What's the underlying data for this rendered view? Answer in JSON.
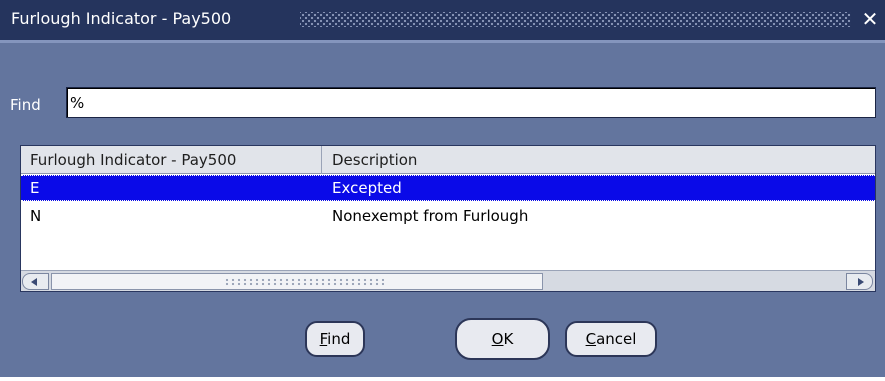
{
  "window": {
    "title": "Furlough Indicator - Pay500",
    "close_label": "✕"
  },
  "find": {
    "label": "Find",
    "value": "%"
  },
  "table": {
    "columns": [
      "Furlough Indicator - Pay500",
      "Description"
    ],
    "rows": [
      {
        "code": "E",
        "description": "Excepted",
        "selected": true
      },
      {
        "code": "N",
        "description": "Nonexempt from Furlough",
        "selected": false
      }
    ]
  },
  "buttons": {
    "find_prefix": "F",
    "find_rest": "ind",
    "ok_prefix": "O",
    "ok_rest": "K",
    "cancel_prefix": "C",
    "cancel_rest": "ancel"
  },
  "colors": {
    "background": "#63759e",
    "titlebar": "#25345d",
    "selection": "#0a0ae8"
  }
}
